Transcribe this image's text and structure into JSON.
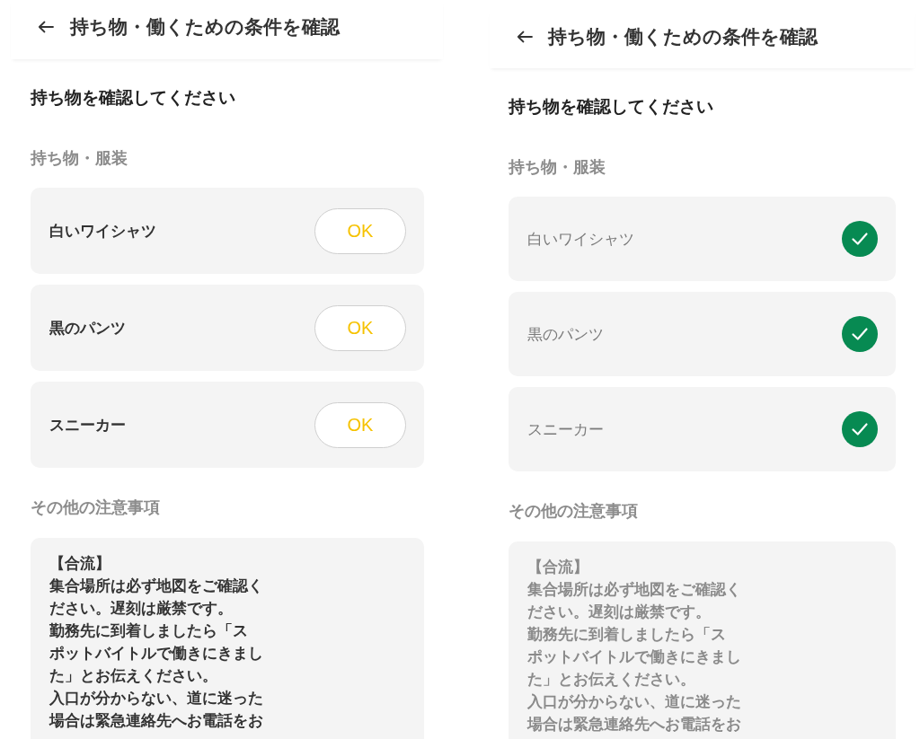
{
  "screens": [
    {
      "header": {
        "title": "持ち物・働くための条件を確認"
      },
      "heading": "持ち物を確認してください",
      "items_section": {
        "label": "持ち物・服装",
        "items": [
          {
            "label": "白いワイシャツ",
            "checked": false,
            "button": "OK"
          },
          {
            "label": "黒のパンツ",
            "checked": false,
            "button": "OK"
          },
          {
            "label": "スニーカー",
            "checked": false,
            "button": "OK"
          }
        ]
      },
      "notes_section": {
        "label": "その他の注意事項",
        "dimmed": false,
        "paragraphs": [
          "【合流】",
          "集合場所は必ず地図をご確認ください。遅刻は厳禁です。",
          "勤務先に到着しましたら「スポットバイトルで働きにきました」とお伝えください。",
          "入口が分からない、道に迷った場合は緊急連絡先へお電話をお"
        ]
      }
    },
    {
      "header": {
        "title": "持ち物・働くための条件を確認"
      },
      "heading": "持ち物を確認してください",
      "items_section": {
        "label": "持ち物・服装",
        "items": [
          {
            "label": "白いワイシャツ",
            "checked": true
          },
          {
            "label": "黒のパンツ",
            "checked": true
          },
          {
            "label": "スニーカー",
            "checked": true
          }
        ]
      },
      "notes_section": {
        "label": "その他の注意事項",
        "dimmed": true,
        "paragraphs": [
          "【合流】",
          "集合場所は必ず地図をご確認ください。遅刻は厳禁です。",
          "勤務先に到着しましたら「スポットバイトルで働きにきました」とお伝えください。",
          "入口が分からない、道に迷った場合は緊急連絡先へお電話をお"
        ]
      }
    }
  ]
}
